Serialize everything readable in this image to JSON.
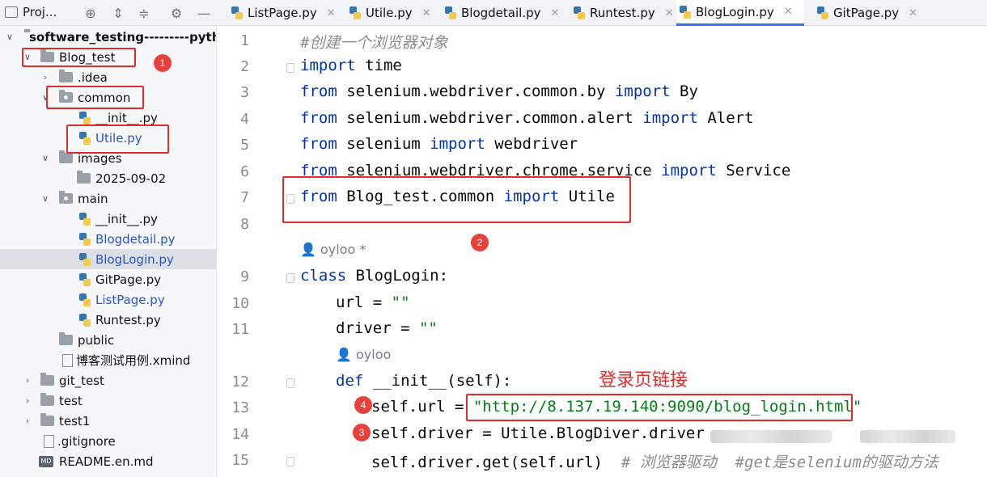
{
  "toolbar": {
    "project_label": "Proj...",
    "icons": [
      "crosshair-icon",
      "expand-all-icon",
      "collapse-all-icon",
      "gear-icon",
      "minimize-icon"
    ]
  },
  "tabs": [
    {
      "label": "ListPage.py",
      "active": false
    },
    {
      "label": "Utile.py",
      "active": false
    },
    {
      "label": "Blogdetail.py",
      "active": false
    },
    {
      "label": "Runtest.py",
      "active": false
    },
    {
      "label": "BlogLogin.py",
      "active": true
    },
    {
      "label": "GitPage.py",
      "active": false
    }
  ],
  "tree": {
    "root": "software_testing---------pyth",
    "items": [
      "Blog_test",
      ".idea",
      "common",
      "__init__.py",
      "Utile.py",
      "images",
      "2025-09-02",
      "main",
      "__init__.py",
      "Blogdetail.py",
      "BlogLogin.py",
      "GitPage.py",
      "ListPage.py",
      "Runtest.py",
      "public",
      "博客测试用例.xmind",
      "git_test",
      "test",
      "test1",
      ".gitignore",
      "README.en.md"
    ]
  },
  "editor": {
    "line_numbers": [
      "1",
      "2",
      "3",
      "4",
      "5",
      "6",
      "7",
      "8",
      "9",
      "10",
      "11",
      "12",
      "13",
      "14",
      "15"
    ],
    "lines": {
      "l1": "#创建一个浏览器对象",
      "l2a": "import",
      "l2b": " time",
      "l3a": "from",
      "l3b": " selenium.webdriver.common.by ",
      "l3c": "import",
      "l3d": " By",
      "l4a": "from",
      "l4b": " selenium.webdriver.common.alert ",
      "l4c": "import",
      "l4d": " Alert",
      "l5a": "from",
      "l5b": " selenium ",
      "l5c": "import",
      "l5d": " webdriver",
      "l6a": "from",
      "l6b": " selenium.webdriver.chrome.service ",
      "l6c": "import",
      "l6d": " Service",
      "l7a": "from",
      "l7b": " Blog_test.common ",
      "l7c": "import",
      "l7d": " Utile",
      "l9a": "class",
      "l9b": " BlogLogin:",
      "l10a": "url = ",
      "l10b": "\"\"",
      "l11a": "driver = ",
      "l11b": "\"\"",
      "l12a": "def",
      "l12b": " __init__(self):",
      "l13a": "self.url = ",
      "l13b": "\"http://8.137.19.140:9090/blog_login.html\"",
      "l14": "self.driver = Utile.BlogDiver.driver",
      "l15a": "self.driver.get(self.url)  ",
      "l15b": "# 浏览器驱动  #get是selenium的驱动方法"
    },
    "author1": "oyloo *",
    "author2": "oyloo"
  },
  "annotations": {
    "badges": [
      "1",
      "2",
      "3",
      "4"
    ],
    "caption": "登录页链接"
  },
  "colors": {
    "keyword": "#0033b3",
    "string": "#067d17",
    "comment": "#8c8c8c",
    "annotation_red": "#e32b2b",
    "tab_active": "#3574f0"
  }
}
